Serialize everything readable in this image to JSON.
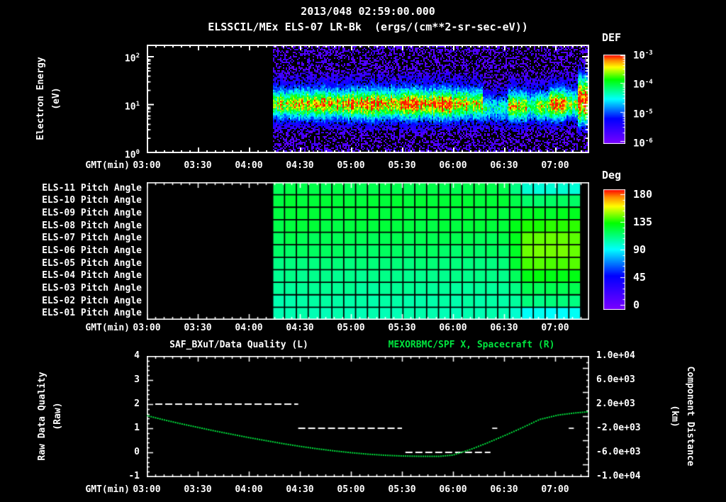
{
  "title": {
    "date": "2013/048 02:59:00.000",
    "instrument": "ELSSCIL/MEx ELS-07 LR-Bk",
    "units": "(ergs/(cm**2-sr-sec-eV))"
  },
  "time_axis": {
    "label": "GMT(min)",
    "ticks": [
      "03:00",
      "03:30",
      "04:00",
      "04:30",
      "05:00",
      "05:30",
      "06:00",
      "06:30",
      "07:00"
    ],
    "start_min": 180,
    "end_min": 440
  },
  "panels": {
    "spectrogram": {
      "ylabel": "Electron Energy",
      "ylabel_units": "(eV)",
      "ytick_exponents": [
        2,
        1,
        0
      ],
      "colorbar": {
        "label": "DEF",
        "tick_exponents": [
          -3,
          -4,
          -5,
          -6
        ]
      }
    },
    "pitch": {
      "row_labels": [
        "ELS-11 Pitch Angle",
        "ELS-10 Pitch Angle",
        "ELS-09 Pitch Angle",
        "ELS-08 Pitch Angle",
        "ELS-07 Pitch Angle",
        "ELS-06 Pitch Angle",
        "ELS-05 Pitch Angle",
        "ELS-04 Pitch Angle",
        "ELS-03 Pitch Angle",
        "ELS-02 Pitch Angle",
        "ELS-01 Pitch Angle"
      ],
      "colorbar": {
        "label": "Deg",
        "ticks": [
          180,
          135,
          90,
          45,
          0
        ]
      }
    },
    "timeseries": {
      "title_left": "SAF_BXuT/Data Quality (L)",
      "title_right": "MEXORBMC/SPF X, Spacecraft (R)",
      "ylabel_left": "Raw Data Quality",
      "ylabel_left_units": "(Raw)",
      "ylabel_right": "Component Distance",
      "ylabel_right_units": "(km)",
      "left_ticks": [
        4,
        3,
        2,
        1,
        0,
        -1
      ],
      "right_ticks": [
        "1.0e+04",
        "6.0e+03",
        "2.0e+03",
        "-2.0e+03",
        "-6.0e+03",
        "-1.0e+04"
      ]
    }
  },
  "colors": {
    "background": "#000000",
    "text": "#ffffff",
    "series_green": "#00e53e",
    "grid_black": "#000000"
  },
  "chart_data": [
    {
      "id": "electron_energy_spectrogram",
      "type": "heatmap",
      "title": "2013/048 02:59:00.000",
      "subtitle": "ELSSCIL/MEx ELS-07 LR-Bk (ergs/(cm**2-sr-sec-eV))",
      "xlabel": "GMT(min)",
      "ylabel": "Electron Energy (eV)",
      "x_range_min": [
        180,
        440
      ],
      "x_tick_labels": [
        "03:00",
        "03:30",
        "04:00",
        "04:30",
        "05:00",
        "05:30",
        "06:00",
        "06:30",
        "07:00"
      ],
      "y_scale": "log",
      "y_range_ev": [
        1,
        300
      ],
      "y_tick_labels": [
        "10^2",
        "10^1",
        "10^0"
      ],
      "colorbar": {
        "label": "DEF",
        "scale": "log",
        "range_flux": [
          1e-06,
          0.001
        ],
        "tick_labels": [
          "10^-3",
          "10^-4",
          "10^-5",
          "10^-6"
        ]
      },
      "data_start_min": 254,
      "band_segments": [
        {
          "start_min": 254,
          "end_min": 268,
          "intensity": 0.8,
          "center_ev": 10
        },
        {
          "start_min": 268,
          "end_min": 300,
          "intensity": 0.92,
          "center_ev": 10
        },
        {
          "start_min": 300,
          "end_min": 360,
          "intensity": 1.0,
          "center_ev": 10
        },
        {
          "start_min": 360,
          "end_min": 378,
          "intensity": 0.93,
          "center_ev": 10
        },
        {
          "start_min": 378,
          "end_min": 393,
          "intensity": 0.45,
          "center_ev": 8
        },
        {
          "start_min": 393,
          "end_min": 404,
          "intensity": 0.8,
          "center_ev": 9
        },
        {
          "start_min": 404,
          "end_min": 409,
          "intensity": 0.55,
          "center_ev": 9
        },
        {
          "start_min": 409,
          "end_min": 417,
          "intensity": 0.75,
          "center_ev": 9
        },
        {
          "start_min": 417,
          "end_min": 427,
          "intensity": 0.95,
          "center_ev": 10
        },
        {
          "start_min": 427,
          "end_min": 434,
          "intensity": 0.7,
          "center_ev": 10
        },
        {
          "start_min": 434,
          "end_min": 441,
          "intensity": 1.1,
          "center_ev": 12,
          "tall": true
        }
      ]
    },
    {
      "id": "pitch_angle_panels",
      "type": "heatmap",
      "colorbar": {
        "label": "Deg",
        "range": [
          0,
          180
        ],
        "ticks": [
          180,
          135,
          90,
          45,
          0
        ]
      },
      "data_start_min": 254,
      "data_end_min": 435,
      "late_transition_min": 398,
      "n_time_cells": 26,
      "rows": [
        {
          "label": "ELS-11 Pitch Angle",
          "deg_main": 118,
          "deg_late": 96
        },
        {
          "label": "ELS-10 Pitch Angle",
          "deg_main": 121,
          "deg_late": 114
        },
        {
          "label": "ELS-09 Pitch Angle",
          "deg_main": 121,
          "deg_late": 124
        },
        {
          "label": "ELS-08 Pitch Angle",
          "deg_main": 120,
          "deg_late": 133
        },
        {
          "label": "ELS-07 Pitch Angle",
          "deg_main": 117,
          "deg_late": 139
        },
        {
          "label": "ELS-06 Pitch Angle",
          "deg_main": 114,
          "deg_late": 140
        },
        {
          "label": "ELS-05 Pitch Angle",
          "deg_main": 111,
          "deg_late": 137
        },
        {
          "label": "ELS-04 Pitch Angle",
          "deg_main": 108,
          "deg_late": 127
        },
        {
          "label": "ELS-03 Pitch Angle",
          "deg_main": 106,
          "deg_late": 117
        },
        {
          "label": "ELS-02 Pitch Angle",
          "deg_main": 104,
          "deg_late": 110
        },
        {
          "label": "ELS-01 Pitch Angle",
          "deg_main": 102,
          "deg_late": 91
        }
      ]
    },
    {
      "id": "quality_and_distance",
      "type": "line",
      "title_left": "SAF_BXuT/Data Quality (L)",
      "title_right": "MEXORBMC/SPF X, Spacecraft (R)",
      "left_axis": {
        "label": "Raw Data Quality (Raw)",
        "range": [
          -1,
          4
        ],
        "ticks": [
          4,
          3,
          2,
          1,
          0,
          -1
        ]
      },
      "right_axis": {
        "label": "Component Distance (km)",
        "range": [
          -10000,
          10000
        ],
        "tick_labels": [
          "1.0e+04",
          "6.0e+03",
          "2.0e+03",
          "-2.0e+03",
          "-6.0e+03",
          "-1.0e+04"
        ]
      },
      "series": [
        {
          "name": "SAF_BXuT/Data Quality (L)",
          "axis": "left",
          "style": "dashed",
          "color": "#ffffff",
          "segments": [
            {
              "value": 2,
              "start_min": 185,
              "end_min": 269
            },
            {
              "value": 1,
              "start_min": 269,
              "end_min": 330
            },
            {
              "value": 0,
              "start_min": 332,
              "end_min": 382
            },
            {
              "value": 1,
              "start_min": 383,
              "end_min": 386
            },
            {
              "value": 1,
              "start_min": 428,
              "end_min": 431
            }
          ]
        },
        {
          "name": "MEXORBMC/SPF X, Spacecraft (R)",
          "axis": "right",
          "style": "dotted",
          "color": "#00e53e",
          "points_min_km": [
            [
              180,
              100
            ],
            [
              190,
              -600
            ],
            [
              200,
              -1250
            ],
            [
              210,
              -1850
            ],
            [
              220,
              -2450
            ],
            [
              230,
              -3000
            ],
            [
              240,
              -3550
            ],
            [
              250,
              -4050
            ],
            [
              260,
              -4550
            ],
            [
              270,
              -5000
            ],
            [
              280,
              -5400
            ],
            [
              290,
              -5750
            ],
            [
              300,
              -6050
            ],
            [
              310,
              -6300
            ],
            [
              320,
              -6480
            ],
            [
              330,
              -6600
            ],
            [
              340,
              -6650
            ],
            [
              352,
              -6660
            ],
            [
              360,
              -6450
            ],
            [
              370,
              -5550
            ],
            [
              380,
              -4450
            ],
            [
              390,
              -3250
            ],
            [
              400,
              -2000
            ],
            [
              411,
              -530
            ],
            [
              422,
              200
            ],
            [
              432,
              550
            ],
            [
              440,
              750
            ]
          ]
        }
      ]
    }
  ]
}
